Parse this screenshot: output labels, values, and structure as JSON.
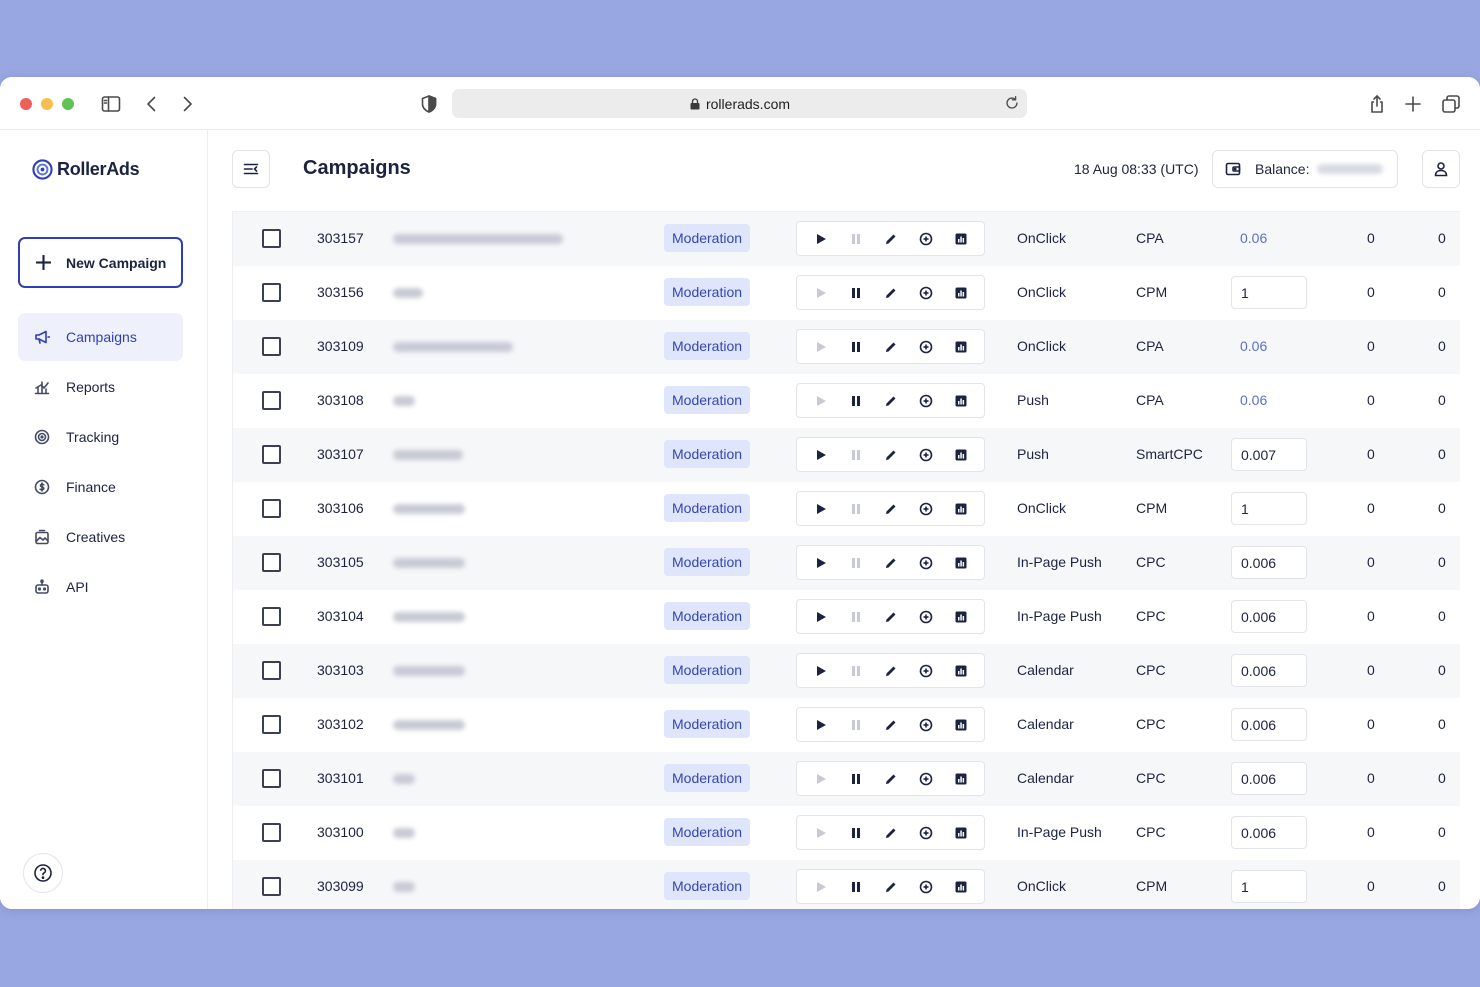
{
  "browser": {
    "url": "rollerads.com"
  },
  "brand": {
    "name": "RollerAds",
    "accent": "#2f3fb5"
  },
  "sidebar": {
    "new_campaign_label": "New Campaign",
    "items": [
      {
        "label": "Campaigns",
        "icon": "megaphone-icon",
        "active": true
      },
      {
        "label": "Reports",
        "icon": "chart-icon",
        "active": false
      },
      {
        "label": "Tracking",
        "icon": "target-icon",
        "active": false
      },
      {
        "label": "Finance",
        "icon": "coin-icon",
        "active": false
      },
      {
        "label": "Creatives",
        "icon": "image-icon",
        "active": false
      },
      {
        "label": "API",
        "icon": "robot-icon",
        "active": false
      }
    ]
  },
  "header": {
    "title": "Campaigns",
    "datetime": "18 Aug 08:33 (UTC)",
    "balance_label": "Balance:"
  },
  "campaigns": [
    {
      "id": "303157",
      "status": "Moderation",
      "running": false,
      "type": "OnClick",
      "model": "CPA",
      "bid": "0.06",
      "bid_editable": false,
      "col1": "0",
      "col2": "0"
    },
    {
      "id": "303156",
      "status": "Moderation",
      "running": true,
      "type": "OnClick",
      "model": "CPM",
      "bid": "1",
      "bid_editable": true,
      "col1": "0",
      "col2": "0"
    },
    {
      "id": "303109",
      "status": "Moderation",
      "running": true,
      "type": "OnClick",
      "model": "CPA",
      "bid": "0.06",
      "bid_editable": false,
      "col1": "0",
      "col2": "0"
    },
    {
      "id": "303108",
      "status": "Moderation",
      "running": true,
      "type": "Push",
      "model": "CPA",
      "bid": "0.06",
      "bid_editable": false,
      "col1": "0",
      "col2": "0"
    },
    {
      "id": "303107",
      "status": "Moderation",
      "running": false,
      "type": "Push",
      "model": "SmartCPC",
      "bid": "0.007",
      "bid_editable": true,
      "col1": "0",
      "col2": "0"
    },
    {
      "id": "303106",
      "status": "Moderation",
      "running": false,
      "type": "OnClick",
      "model": "CPM",
      "bid": "1",
      "bid_editable": true,
      "col1": "0",
      "col2": "0"
    },
    {
      "id": "303105",
      "status": "Moderation",
      "running": false,
      "type": "In-Page Push",
      "model": "CPC",
      "bid": "0.006",
      "bid_editable": true,
      "col1": "0",
      "col2": "0"
    },
    {
      "id": "303104",
      "status": "Moderation",
      "running": false,
      "type": "In-Page Push",
      "model": "CPC",
      "bid": "0.006",
      "bid_editable": true,
      "col1": "0",
      "col2": "0"
    },
    {
      "id": "303103",
      "status": "Moderation",
      "running": false,
      "type": "Calendar",
      "model": "CPC",
      "bid": "0.006",
      "bid_editable": true,
      "col1": "0",
      "col2": "0"
    },
    {
      "id": "303102",
      "status": "Moderation",
      "running": false,
      "type": "Calendar",
      "model": "CPC",
      "bid": "0.006",
      "bid_editable": true,
      "col1": "0",
      "col2": "0"
    },
    {
      "id": "303101",
      "status": "Moderation",
      "running": true,
      "type": "Calendar",
      "model": "CPC",
      "bid": "0.006",
      "bid_editable": true,
      "col1": "0",
      "col2": "0"
    },
    {
      "id": "303100",
      "status": "Moderation",
      "running": true,
      "type": "In-Page Push",
      "model": "CPC",
      "bid": "0.006",
      "bid_editable": true,
      "col1": "0",
      "col2": "0"
    },
    {
      "id": "303099",
      "status": "Moderation",
      "running": true,
      "type": "OnClick",
      "model": "CPM",
      "bid": "1",
      "bid_editable": true,
      "col1": "0",
      "col2": "0"
    }
  ]
}
